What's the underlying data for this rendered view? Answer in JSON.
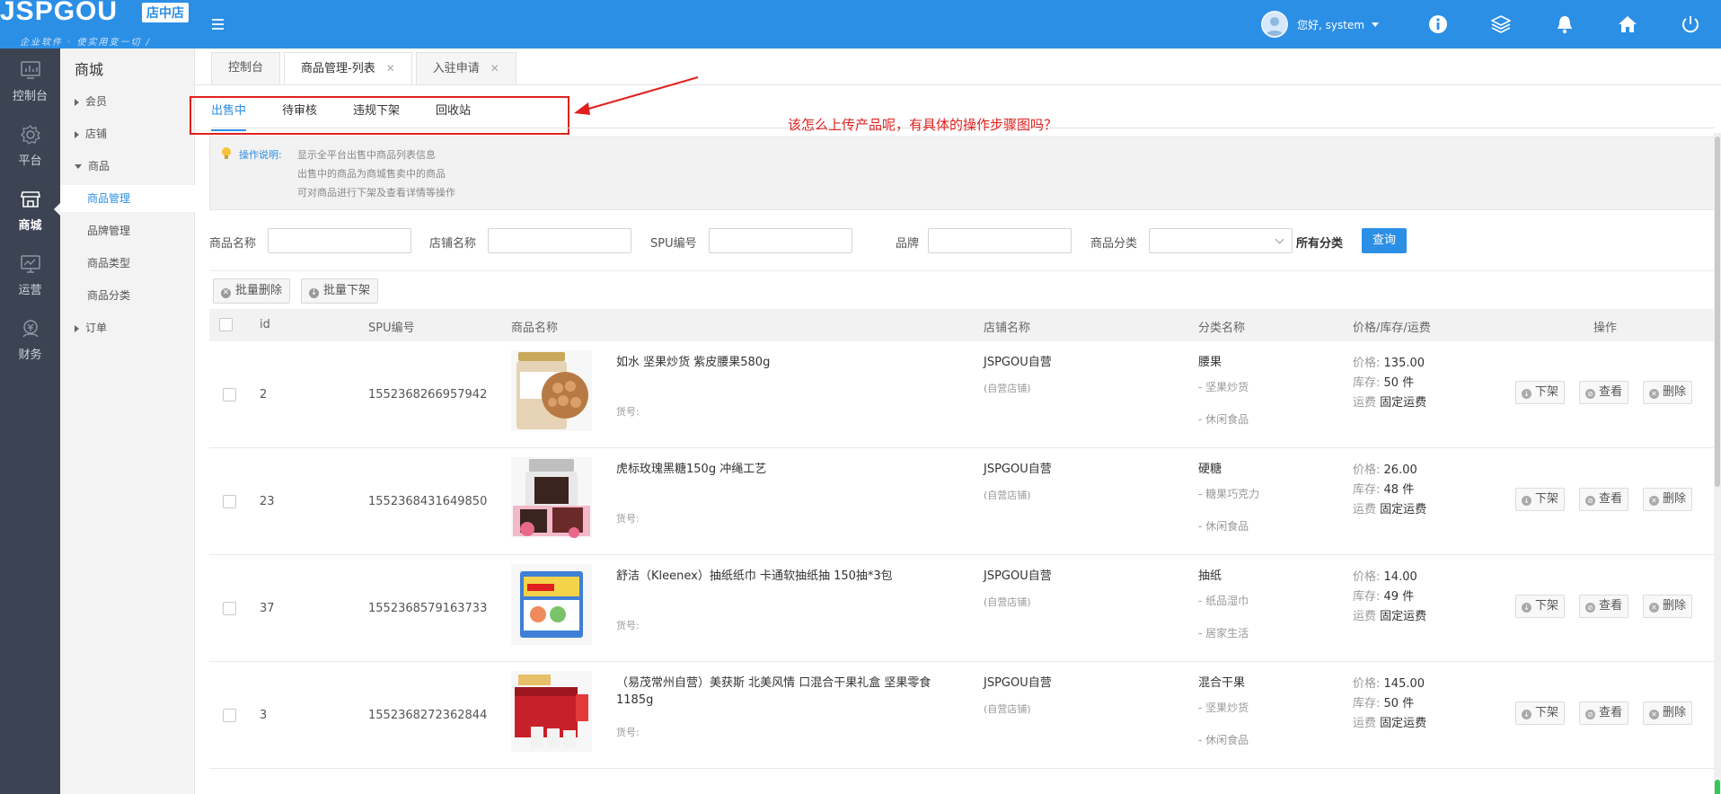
{
  "header": {
    "logo_text": "JSPGOU",
    "logo_badge": "店中店",
    "logo_slogan": "企业软件 · 使实用变一切 /",
    "greeting": "您好, system",
    "icons": [
      "info-icon",
      "layers-icon",
      "bell-icon",
      "home-icon",
      "power-icon"
    ],
    "accent_color": "#2b8fe6"
  },
  "rail": {
    "items": [
      {
        "label": "控制台",
        "icon": "dashboard-icon"
      },
      {
        "label": "平台",
        "icon": "settings-icon"
      },
      {
        "label": "商城",
        "icon": "store-icon",
        "active": true
      },
      {
        "label": "运营",
        "icon": "monitor-icon"
      },
      {
        "label": "财务",
        "icon": "finance-icon"
      }
    ]
  },
  "subnav": {
    "title": "商城",
    "items": [
      {
        "label": "会员",
        "type": "group",
        "expanded": false
      },
      {
        "label": "店铺",
        "type": "group",
        "expanded": false
      },
      {
        "label": "商品",
        "type": "group",
        "expanded": true
      },
      {
        "label": "商品管理",
        "type": "child",
        "active": true
      },
      {
        "label": "品牌管理",
        "type": "child"
      },
      {
        "label": "商品类型",
        "type": "child"
      },
      {
        "label": "商品分类",
        "type": "child"
      },
      {
        "label": "订单",
        "type": "group",
        "expanded": false
      }
    ]
  },
  "tabs": [
    {
      "label": "控制台",
      "closable": false,
      "active": false
    },
    {
      "label": "商品管理-列表",
      "closable": true,
      "active": true
    },
    {
      "label": "入驻申请",
      "closable": true,
      "active": false
    }
  ],
  "subtabs": [
    "出售中",
    "待审核",
    "违规下架",
    "回收站"
  ],
  "annotation": "该怎么上传产品呢，有具体的操作步骤图吗？",
  "notice": {
    "title": "操作说明:",
    "lines": [
      "显示全平台出售中商品列表信息",
      "出售中的商品为商城售卖中的商品",
      "可对商品进行下架及查看详情等操作"
    ]
  },
  "filters": {
    "product_name": "商品名称",
    "shop_name": "店铺名称",
    "spu": "SPU编号",
    "brand": "品牌",
    "category": "商品分类",
    "all_categories": "所有分类",
    "query": "查询"
  },
  "bulk": {
    "delete": "批量删除",
    "off_shelf": "批量下架"
  },
  "table": {
    "headers": {
      "id": "id",
      "spu": "SPU编号",
      "name": "商品名称",
      "shop": "店铺名称",
      "category": "分类名称",
      "price": "价格/库存/运费",
      "ops": "操作"
    },
    "labels": {
      "code": "货号:",
      "price": "价格:",
      "stock": "库存:",
      "freight": "运费",
      "off": "下架",
      "view": "查看",
      "delete": "删除"
    },
    "rows": [
      {
        "id": "2",
        "spu": "1552368266957942",
        "name": "如水 坚果炒货 紫皮腰果580g",
        "shop": "JSPGOU自营",
        "shop_type": "(自营店铺)",
        "cat_main": "腰果",
        "cat_sub1": "- 坚果炒货",
        "cat_sub2": "- 休闲食品",
        "price": "135.00",
        "stock": "50 件",
        "freight": "固定运费"
      },
      {
        "id": "23",
        "spu": "1552368431649850",
        "name": "虎标玫瑰黑糖150g 冲绳工艺",
        "shop": "JSPGOU自营",
        "shop_type": "(自营店铺)",
        "cat_main": "硬糖",
        "cat_sub1": "- 糖果巧克力",
        "cat_sub2": "- 休闲食品",
        "price": "26.00",
        "stock": "48 件",
        "freight": "固定运费"
      },
      {
        "id": "37",
        "spu": "1552368579163733",
        "name": "舒洁（Kleenex）抽纸纸巾 卡通软抽纸抽 150抽*3包",
        "shop": "JSPGOU自营",
        "shop_type": "(自营店铺)",
        "cat_main": "抽纸",
        "cat_sub1": "- 纸品湿巾",
        "cat_sub2": "- 居家生活",
        "price": "14.00",
        "stock": "49 件",
        "freight": "固定运费"
      },
      {
        "id": "3",
        "spu": "1552368272362844",
        "name": "（易茂常州自营）美获斯 北美风情 口混合干果礼盒 坚果零食1185g",
        "shop": "JSPGOU自营",
        "shop_type": "(自营店铺)",
        "cat_main": "混合干果",
        "cat_sub1": "- 坚果炒货",
        "cat_sub2": "- 休闲食品",
        "price": "145.00",
        "stock": "50 件",
        "freight": "固定运费"
      }
    ]
  }
}
